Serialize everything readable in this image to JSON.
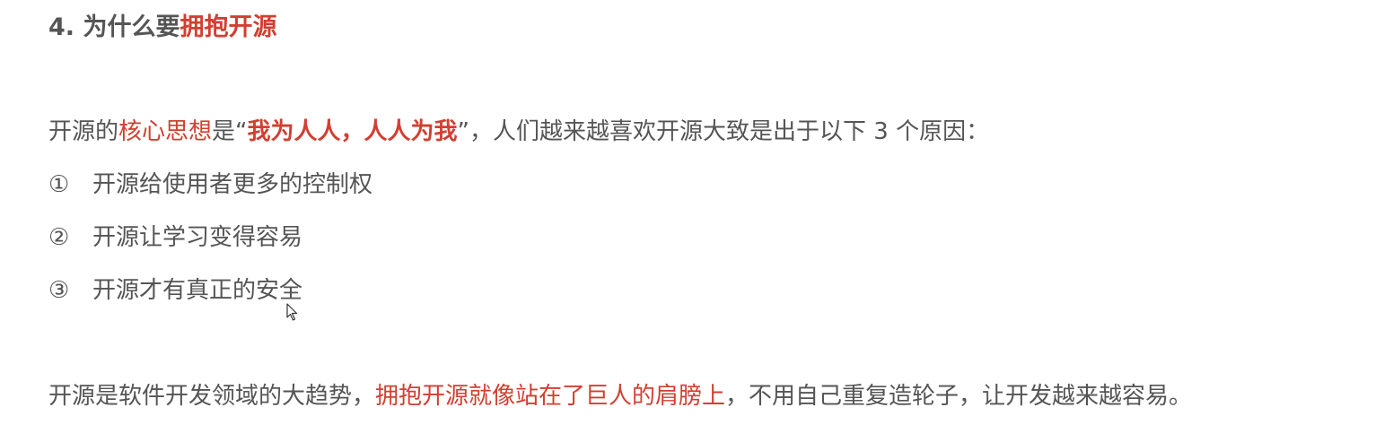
{
  "heading": {
    "prefix": "4. 为什么要",
    "highlight": "拥抱开源"
  },
  "intro": {
    "part1": "开源的",
    "highlight1": "核心思想",
    "part2": "是“",
    "highlight2": "我为人人，人人为我",
    "part3": "”，人们越来越喜欢开源大致是出于以下 3 个原因："
  },
  "reasons": [
    {
      "num": "①",
      "text": "开源给使用者更多的控制权"
    },
    {
      "num": "②",
      "text": "开源让学习变得容易"
    },
    {
      "num": "③",
      "text": "开源才有真正的安全"
    }
  ],
  "conclusion": {
    "part1": "开源是软件开发领域的大趋势，",
    "highlight": "拥抱开源就像站在了巨人的肩膀上",
    "part2": "，不用自己重复造轮子，让开发越来越容易。"
  },
  "colors": {
    "text": "#555555",
    "accent": "#d23f31"
  }
}
